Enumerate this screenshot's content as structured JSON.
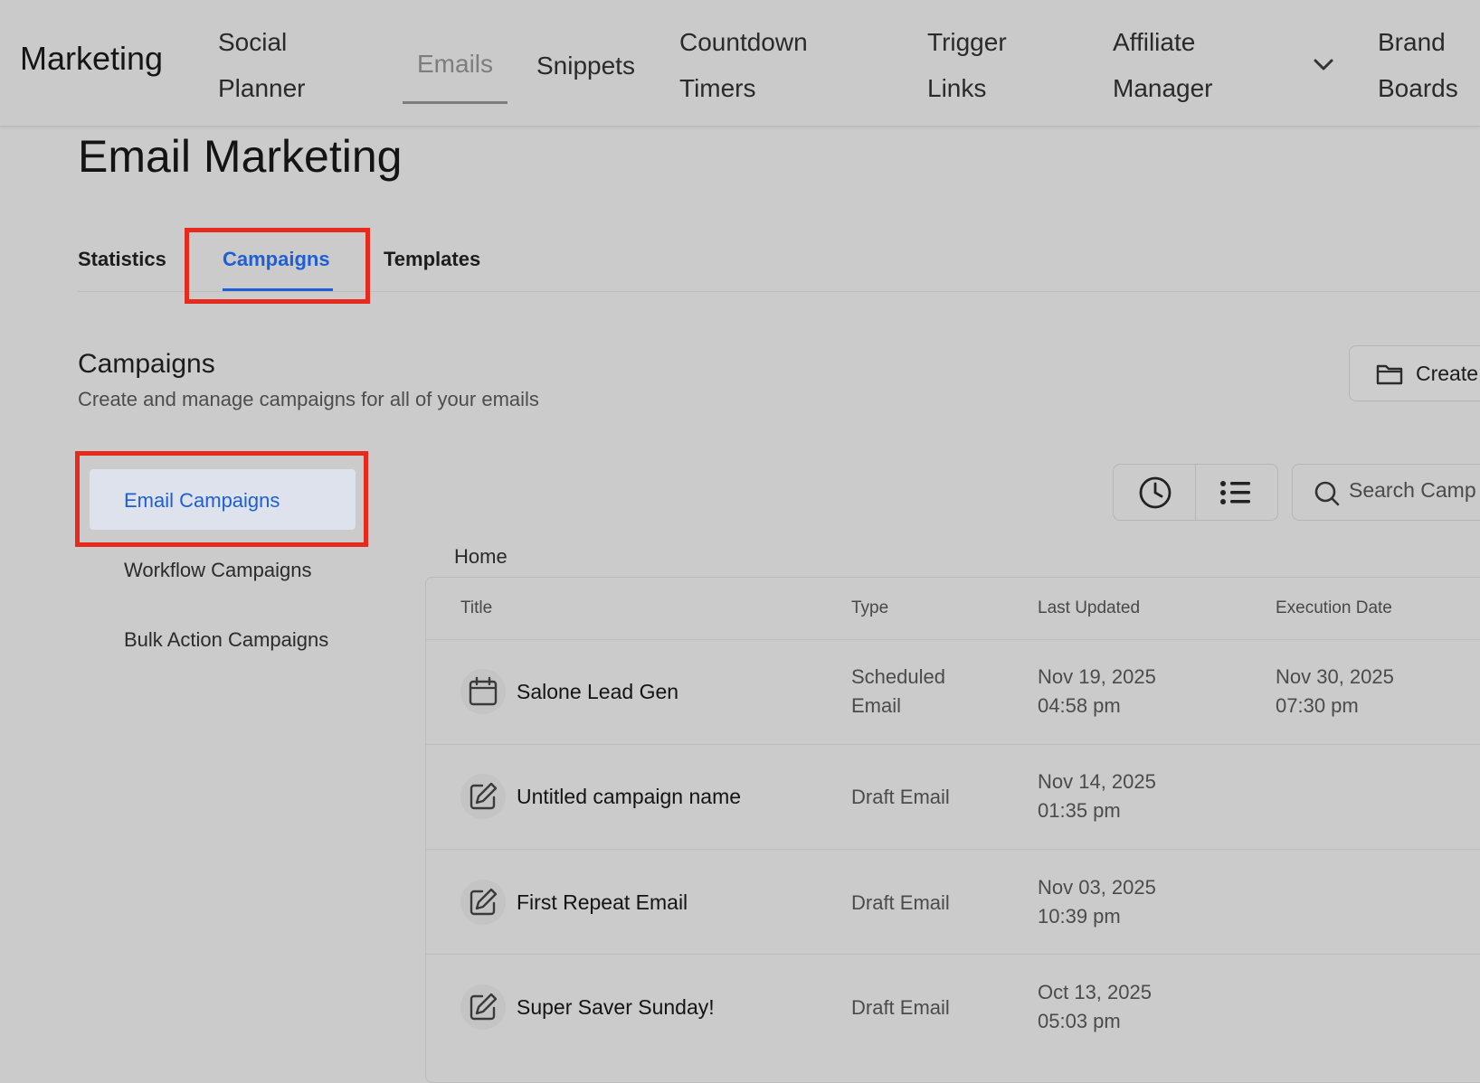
{
  "nav": {
    "brand": "Marketing",
    "items": [
      {
        "line1": "Social",
        "line2": "Planner"
      },
      {
        "label": "Emails"
      },
      {
        "label": "Snippets"
      },
      {
        "line1": "Countdown",
        "line2": "Timers"
      },
      {
        "line1": "Trigger",
        "line2": "Links"
      },
      {
        "line1": "Affiliate",
        "line2": "Manager"
      },
      {
        "line1": "Brand",
        "line2": "Boards"
      }
    ],
    "active": "Emails"
  },
  "page_title": "Email Marketing",
  "tabs": [
    "Statistics",
    "Campaigns",
    "Templates"
  ],
  "active_tab": "Campaigns",
  "section": {
    "title": "Campaigns",
    "subtitle": "Create and manage campaigns for all of your emails",
    "create_button": "Create"
  },
  "sidebar": {
    "items": [
      "Email Campaigns",
      "Workflow Campaigns",
      "Bulk Action Campaigns"
    ],
    "active": "Email Campaigns"
  },
  "search": {
    "placeholder": "Search Camp"
  },
  "breadcrumb": "Home",
  "table": {
    "columns": [
      "Title",
      "Type",
      "Last Updated",
      "Execution Date"
    ],
    "rows": [
      {
        "icon": "calendar-icon",
        "title": "Salone Lead Gen",
        "type": [
          "Scheduled",
          "Email"
        ],
        "updated": [
          "Nov 19, 2025",
          "04:58 pm"
        ],
        "execution": [
          "Nov 30, 2025",
          "07:30 pm"
        ]
      },
      {
        "icon": "edit-icon",
        "title": "Untitled campaign name",
        "type": [
          "Draft Email"
        ],
        "updated": [
          "Nov 14, 2025",
          "01:35 pm"
        ],
        "execution": []
      },
      {
        "icon": "edit-icon",
        "title": "First Repeat Email",
        "type": [
          "Draft Email"
        ],
        "updated": [
          "Nov 03, 2025",
          "10:39 pm"
        ],
        "execution": []
      },
      {
        "icon": "edit-icon",
        "title": "Super Saver Sunday!",
        "type": [
          "Draft Email"
        ],
        "updated": [
          "Oct 13, 2025",
          "05:03 pm"
        ],
        "execution": []
      }
    ]
  },
  "colors": {
    "accent": "#1f5fd6",
    "highlight": "#e62b1e",
    "background": "#cbcbcb"
  }
}
